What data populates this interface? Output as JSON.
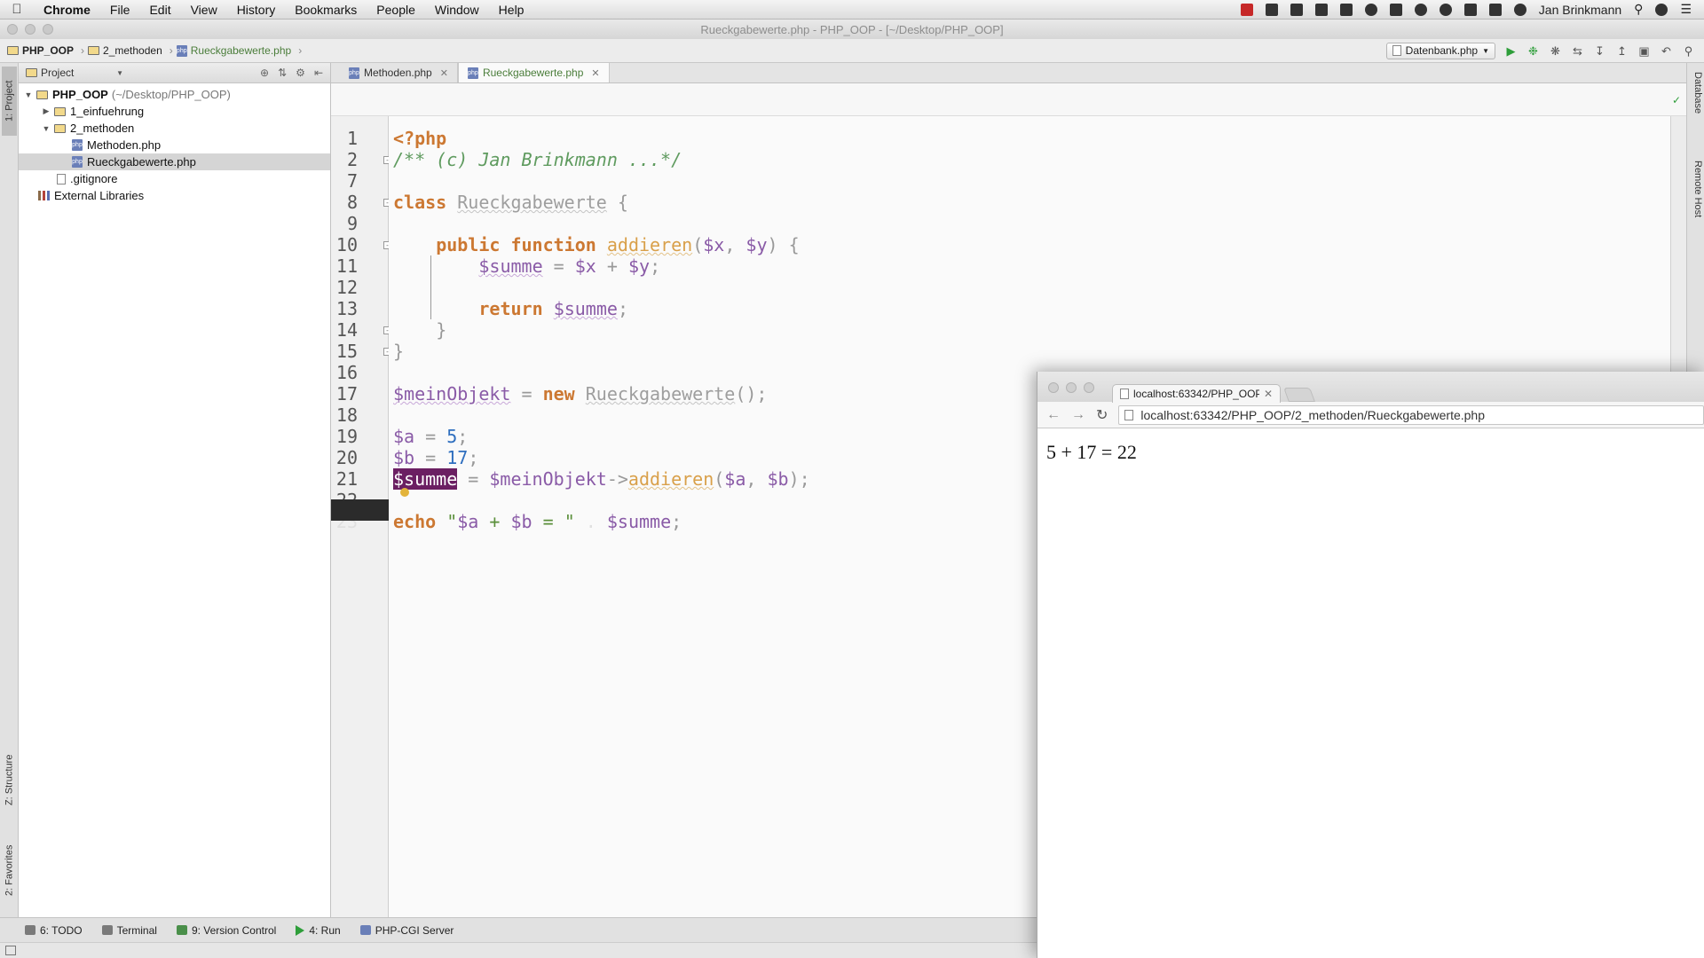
{
  "menubar": {
    "app": "Chrome",
    "items": [
      "File",
      "Edit",
      "View",
      "History",
      "Bookmarks",
      "People",
      "Window",
      "Help"
    ],
    "user": "Jan Brinkmann"
  },
  "window": {
    "title": "Rueckgabewerte.php - PHP_OOP - [~/Desktop/PHP_OOP]"
  },
  "breadcrumb": [
    "PHP_OOP",
    "2_methoden",
    "Rueckgabewerte.php"
  ],
  "toolbar": {
    "run_config": "Datenbank.php"
  },
  "left_strip": {
    "project_tab": "1: Project",
    "structure_tab": "Z: Structure",
    "favorites_tab": "2: Favorites"
  },
  "right_strip": {
    "database_tab": "Database",
    "remote_tab": "Remote Host"
  },
  "project_panel": {
    "selector": "Project",
    "tree": [
      {
        "label": "PHP_OOP",
        "note": "(~/Desktop/PHP_OOP)",
        "type": "folder",
        "level": 0,
        "expanded": true
      },
      {
        "label": "1_einfuehrung",
        "type": "folder",
        "level": 1,
        "expanded": false
      },
      {
        "label": "2_methoden",
        "type": "folder",
        "level": 1,
        "expanded": true
      },
      {
        "label": "Methoden.php",
        "type": "php",
        "level": 2
      },
      {
        "label": "Rueckgabewerte.php",
        "type": "php",
        "level": 2,
        "selected": true
      },
      {
        "label": ".gitignore",
        "type": "file",
        "level": 1
      },
      {
        "label": "External Libraries",
        "type": "library",
        "level": 0
      }
    ]
  },
  "editor": {
    "tabs": [
      {
        "label": "Methoden.php",
        "active": false
      },
      {
        "label": "Rueckgabewerte.php",
        "active": true
      }
    ],
    "line_numbers": [
      "1",
      "2",
      "7",
      "8",
      "9",
      "10",
      "11",
      "12",
      "13",
      "14",
      "15",
      "16",
      "17",
      "18",
      "19",
      "20",
      "21",
      "22",
      "23"
    ],
    "current_line": "23",
    "code": {
      "l1": "<?php",
      "l2": "/** (c) Jan Brinkmann ...*/",
      "l8_kw": "class",
      "l8_name": "Rueckgabewerte",
      "l8_brace": " {",
      "l10_kw": "public function",
      "l10_fn": "addieren",
      "l10_p1": "(",
      "l10_x": "$x",
      "l10_comma": ", ",
      "l10_y": "$y",
      "l10_end": ") {",
      "l11_var": "$summe",
      "l11_eq": " = ",
      "l11_x": "$x",
      "l11_plus": " + ",
      "l11_y": "$y",
      "l11_semi": ";",
      "l13_kw": "return",
      "l13_var": "$summe",
      "l13_semi": ";",
      "l14": "}",
      "l15": "}",
      "l17_var": "$meinObjekt",
      "l17_eq": " = ",
      "l17_new": "new",
      "l17_cls": "Rueckgabewerte",
      "l17_end": "();",
      "l19_var": "$a",
      "l19_eq": " = ",
      "l19_num": "5",
      "l19_semi": ";",
      "l20_var": "$b",
      "l20_eq": " = ",
      "l20_num": "17",
      "l20_semi": ";",
      "l21_var": "$summe",
      "l21_eq": " = ",
      "l21_obj": "$meinObjekt",
      "l21_arrow": "->",
      "l21_fn": "addieren",
      "l21_p1": "(",
      "l21_a": "$a",
      "l21_comma": ", ",
      "l21_b": "$b",
      "l21_end": ");",
      "l23_kw": "echo",
      "l23_str1": "\"",
      "l23_a": "$a",
      "l23_str2": " + ",
      "l23_b": "$b",
      "l23_str3": " = \"",
      "l23_dot": " . ",
      "l23_var": "$summe",
      "l23_semi": ";"
    }
  },
  "bottom_tools": [
    {
      "label": "6: TODO"
    },
    {
      "label": "Terminal"
    },
    {
      "label": "9: Version Control"
    },
    {
      "label": "4: Run"
    },
    {
      "label": "PHP-CGI Server"
    }
  ],
  "browser": {
    "tab_title": "localhost:63342/PHP_OOP",
    "url": "localhost:63342/PHP_OOP/2_methoden/Rueckgabewerte.php",
    "output": "5 + 17 = 22"
  }
}
